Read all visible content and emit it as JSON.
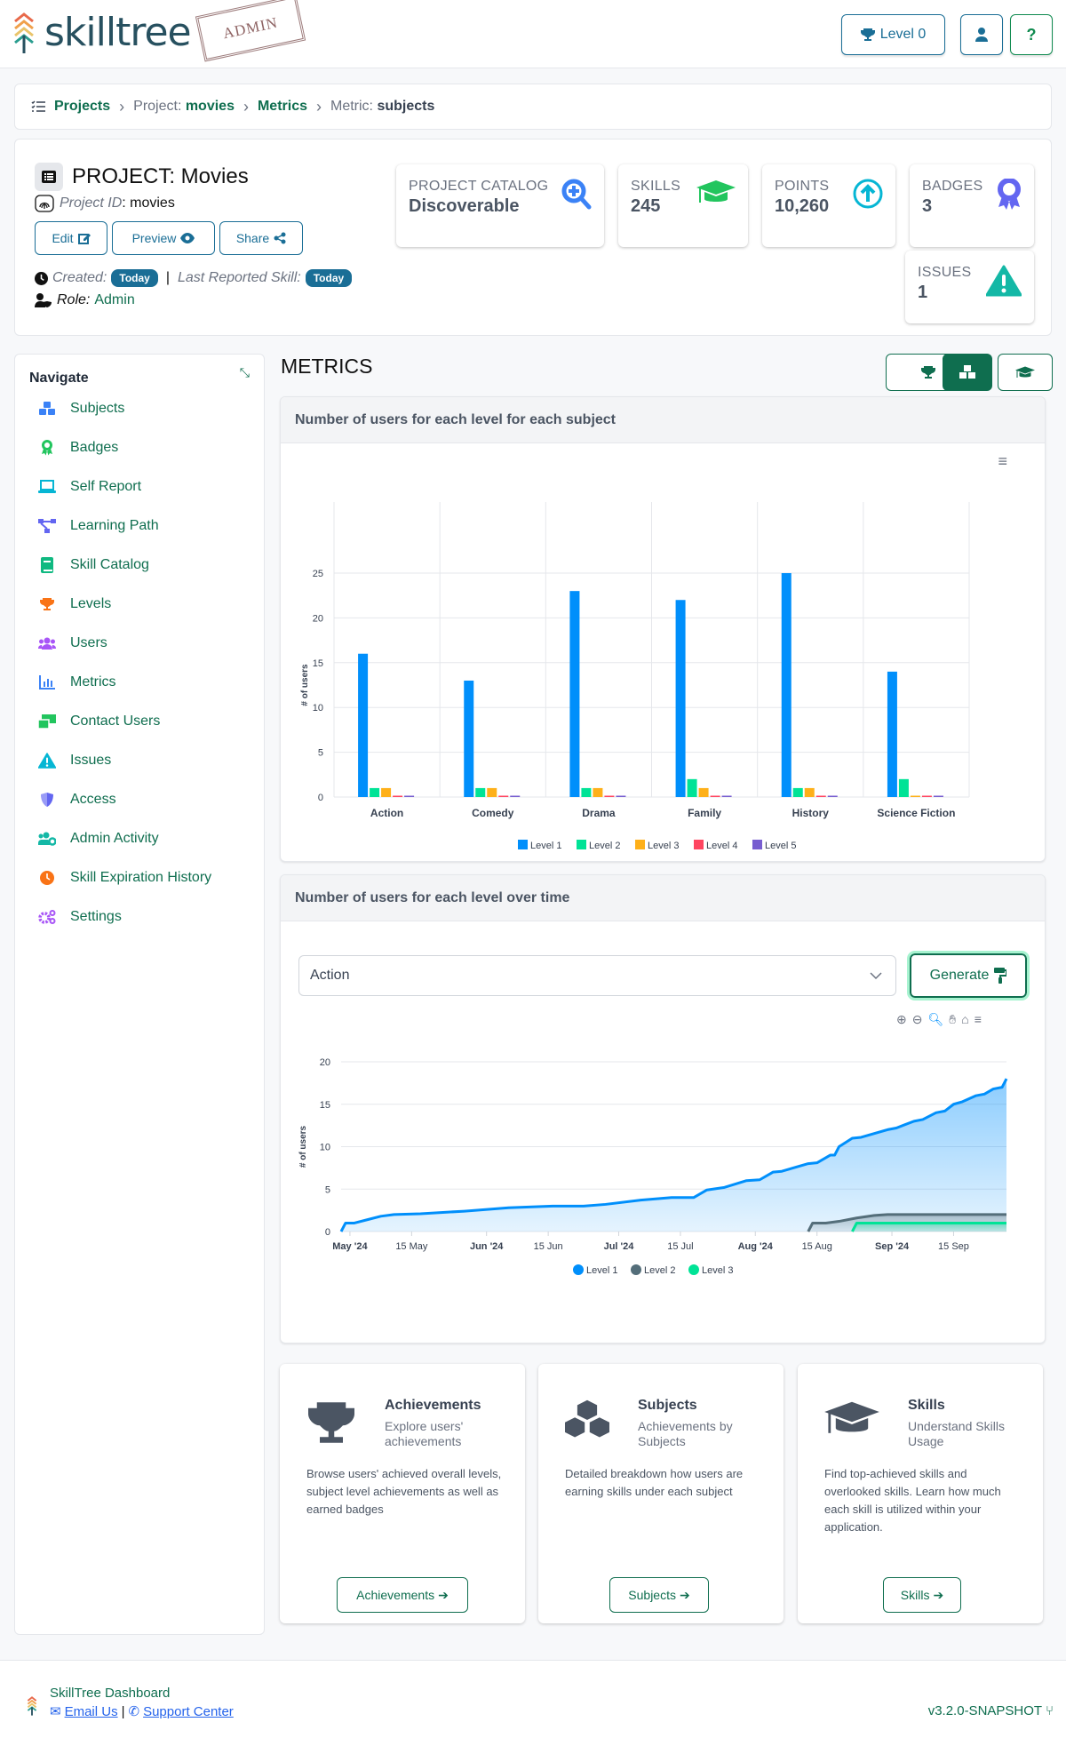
{
  "header": {
    "logo_text": "skilltree",
    "stamp_text": "ADMIN",
    "level_button": "Level 0",
    "user_button_icon": "user-icon",
    "help_button_icon": "question-icon"
  },
  "breadcrumb": {
    "items": [
      {
        "label": "Projects"
      },
      {
        "prefix": "Project: ",
        "label": "movies"
      },
      {
        "label": "Metrics"
      },
      {
        "prefix": "Metric: ",
        "label": "subjects"
      }
    ]
  },
  "project": {
    "title": "PROJECT: Movies",
    "id_label": "Project ID",
    "id_value": ": movies",
    "buttons": {
      "edit": "Edit",
      "preview": "Preview",
      "share": "Share"
    },
    "created_label": "Created:",
    "created_value": "Today",
    "last_reported_label": "Last Reported Skill:",
    "last_reported_value": "Today",
    "role_label": "Role:",
    "role_value": "Admin"
  },
  "stats": [
    {
      "label": "PROJECT CATALOG",
      "value": "Discoverable",
      "icon": "search-plus-icon",
      "color": "#3b82f6"
    },
    {
      "label": "SKILLS",
      "value": "245",
      "icon": "graduation-cap-icon",
      "color": "#22c55e"
    },
    {
      "label": "POINTS",
      "value": "10,260",
      "icon": "arrow-circle-up-icon",
      "color": "#06b6d4"
    },
    {
      "label": "BADGES",
      "value": "3",
      "icon": "award-icon",
      "color": "#6366f1"
    },
    {
      "label": "ISSUES",
      "value": "1",
      "icon": "warning-icon",
      "color": "#14b8a6"
    }
  ],
  "nav": {
    "title": "Navigate",
    "items": [
      {
        "label": "Subjects",
        "icon": "cubes-icon",
        "color": "#3b82f6"
      },
      {
        "label": "Badges",
        "icon": "award-icon",
        "color": "#22c55e"
      },
      {
        "label": "Self Report",
        "icon": "laptop-icon",
        "color": "#06b6d4"
      },
      {
        "label": "Learning Path",
        "icon": "network-icon",
        "color": "#6366f1"
      },
      {
        "label": "Skill Catalog",
        "icon": "book-icon",
        "color": "#10b981"
      },
      {
        "label": "Levels",
        "icon": "trophy-icon",
        "color": "#f97316"
      },
      {
        "label": "Users",
        "icon": "users-icon",
        "color": "#a855f7"
      },
      {
        "label": "Metrics",
        "icon": "chart-icon",
        "color": "#3b82f6"
      },
      {
        "label": "Contact Users",
        "icon": "mail-bulk-icon",
        "color": "#22c55e"
      },
      {
        "label": "Issues",
        "icon": "warning-icon",
        "color": "#06b6d4"
      },
      {
        "label": "Access",
        "icon": "shield-icon",
        "color": "#6366f1"
      },
      {
        "label": "Admin Activity",
        "icon": "users-cog-icon",
        "color": "#14b8a6"
      },
      {
        "label": "Skill Expiration History",
        "icon": "clock-icon",
        "color": "#f97316"
      },
      {
        "label": "Settings",
        "icon": "cogs-icon",
        "color": "#a855f7"
      }
    ]
  },
  "metrics": {
    "title": "METRICS",
    "tab_icons": [
      "trophy-icon",
      "cubes-icon",
      "graduation-cap-icon"
    ],
    "active_tab": 1
  },
  "bar_panel": {
    "title": "Number of users for each level for each subject"
  },
  "line_panel": {
    "title": "Number of users for each level over time",
    "select_value": "Action",
    "generate_label": "Generate"
  },
  "chart_data": [
    {
      "type": "bar",
      "title": "Number of users for each level for each subject",
      "xlabel": "",
      "ylabel": "# of users",
      "ylim": [
        0,
        25
      ],
      "yticks": [
        0,
        5,
        10,
        15,
        20,
        25
      ],
      "grid": true,
      "legend": "bottom",
      "categories": [
        "Action",
        "Comedy",
        "Drama",
        "Family",
        "History",
        "Science Fiction"
      ],
      "series": [
        {
          "name": "Level 1",
          "color": "#008ffb",
          "values": [
            16,
            13,
            23,
            22,
            25,
            14
          ]
        },
        {
          "name": "Level 2",
          "color": "#00e396",
          "values": [
            1,
            1,
            1,
            2,
            1,
            2
          ]
        },
        {
          "name": "Level 3",
          "color": "#feb019",
          "values": [
            1,
            1,
            1,
            1,
            1,
            0
          ]
        },
        {
          "name": "Level 4",
          "color": "#ff4560",
          "values": [
            0,
            0,
            0,
            0,
            0,
            0
          ]
        },
        {
          "name": "Level 5",
          "color": "#775dd0",
          "values": [
            0,
            0,
            0,
            0,
            0,
            0
          ]
        }
      ]
    },
    {
      "type": "area",
      "title": "Number of users for each level over time",
      "ylabel": "# of users",
      "ylim": [
        0,
        20
      ],
      "yticks": [
        0,
        5,
        10,
        15,
        20
      ],
      "grid": true,
      "legend": "bottom",
      "x_range_days": [
        0,
        150
      ],
      "xticks": [
        {
          "label": "May '24",
          "day": 2,
          "bold": true
        },
        {
          "label": "15 May",
          "day": 16,
          "bold": false
        },
        {
          "label": "Jun '24",
          "day": 33,
          "bold": true
        },
        {
          "label": "15 Jun",
          "day": 47,
          "bold": false
        },
        {
          "label": "Jul '24",
          "day": 63,
          "bold": true
        },
        {
          "label": "15 Jul",
          "day": 77,
          "bold": false
        },
        {
          "label": "Aug '24",
          "day": 94,
          "bold": true
        },
        {
          "label": "15 Aug",
          "day": 108,
          "bold": false
        },
        {
          "label": "Sep '24",
          "day": 125,
          "bold": true
        },
        {
          "label": "15 Sep",
          "day": 139,
          "bold": false
        }
      ],
      "series": [
        {
          "name": "Level 1",
          "color": "#008ffb",
          "points": [
            [
              0,
              0
            ],
            [
              1,
              1
            ],
            [
              3,
              1
            ],
            [
              6,
              1.4
            ],
            [
              9,
              1.8
            ],
            [
              12,
              2
            ],
            [
              18,
              2.1
            ],
            [
              28,
              2.4
            ],
            [
              38,
              2.8
            ],
            [
              48,
              3
            ],
            [
              55,
              3
            ],
            [
              60,
              3.2
            ],
            [
              68,
              3.7
            ],
            [
              75,
              4
            ],
            [
              80,
              4
            ],
            [
              83,
              4.9
            ],
            [
              87,
              5.2
            ],
            [
              92,
              6
            ],
            [
              95,
              6.1
            ],
            [
              98,
              7
            ],
            [
              100,
              7.1
            ],
            [
              106,
              8
            ],
            [
              108,
              8.1
            ],
            [
              111,
              9
            ],
            [
              112,
              9
            ],
            [
              113,
              10
            ],
            [
              116,
              11
            ],
            [
              118,
              11.1
            ],
            [
              124,
              12
            ],
            [
              126,
              12.2
            ],
            [
              130,
              13
            ],
            [
              132,
              13.2
            ],
            [
              135,
              14
            ],
            [
              137,
              14.2
            ],
            [
              139,
              15
            ],
            [
              141,
              15.3
            ],
            [
              144,
              16
            ],
            [
              146,
              16.2
            ],
            [
              148,
              16.8
            ],
            [
              150,
              17
            ],
            [
              151,
              18
            ]
          ]
        },
        {
          "name": "Level 2",
          "color": "#546e7a",
          "points": [
            [
              106,
              0
            ],
            [
              107,
              1
            ],
            [
              110,
              1
            ],
            [
              113,
              1.2
            ],
            [
              117,
              1.6
            ],
            [
              121,
              1.9
            ],
            [
              124,
              2
            ],
            [
              151,
              2
            ]
          ]
        },
        {
          "name": "Level 3",
          "color": "#00e396",
          "points": [
            [
              116,
              0
            ],
            [
              117,
              1
            ],
            [
              151,
              1
            ]
          ]
        }
      ]
    }
  ],
  "tiles": [
    {
      "title": "Achievements",
      "subtitle": "Explore users' achievements",
      "description": "Browse users' achieved overall levels, subject level achievements as well as earned badges",
      "button": "Achievements",
      "icon": "trophy-icon"
    },
    {
      "title": "Subjects",
      "subtitle": "Achievements by Subjects",
      "description": "Detailed breakdown how users are earning skills under each subject",
      "button": "Subjects",
      "icon": "cubes-icon"
    },
    {
      "title": "Skills",
      "subtitle": "Understand Skills Usage",
      "description": "Find top-achieved skills and overlooked skills. Learn how much each skill is utilized within your application.",
      "button": "Skills",
      "icon": "graduation-cap-icon"
    }
  ],
  "footer": {
    "title": "SkillTree Dashboard",
    "email": "Email Us",
    "support": "Support Center",
    "version": "v3.2.0-SNAPSHOT"
  }
}
